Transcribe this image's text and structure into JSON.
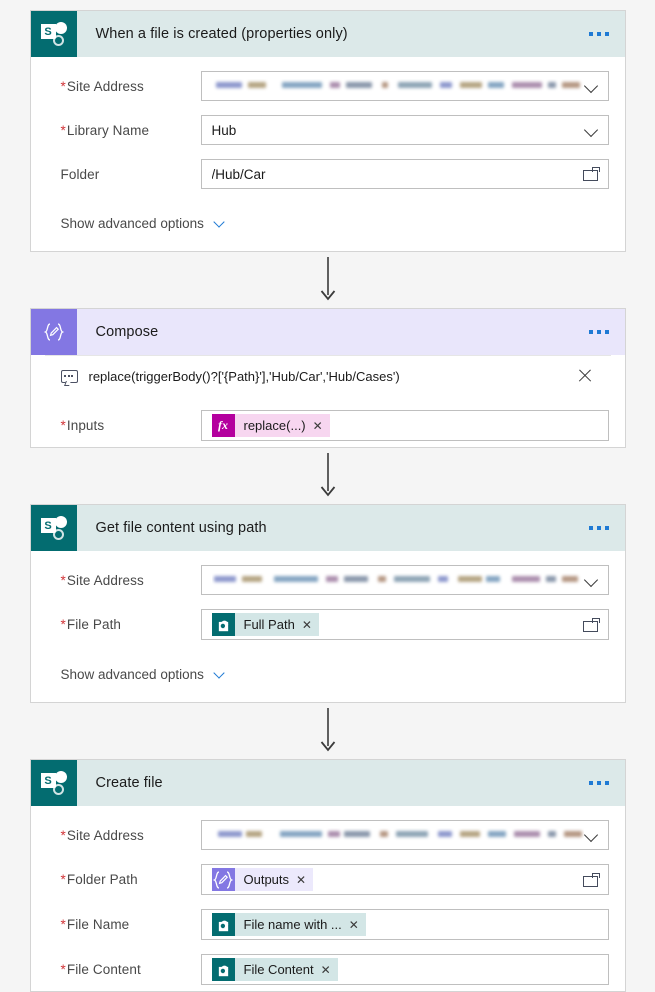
{
  "flow": {
    "blocks": [
      {
        "id": "trigger",
        "title": "When a file is created (properties only)",
        "icon": "sharepoint-icon",
        "theme": "sp",
        "fields": [
          {
            "label": "Site Address",
            "required": true,
            "type": "dropdown-blurred",
            "value": ""
          },
          {
            "label": "Library Name",
            "required": true,
            "type": "dropdown",
            "value": "Hub"
          },
          {
            "label": "Folder",
            "required": false,
            "type": "folder-picker",
            "value": "/Hub/Car"
          }
        ],
        "advanced_label": "Show advanced options"
      },
      {
        "id": "compose",
        "title": "Compose",
        "icon": "compose-icon",
        "theme": "cmp",
        "expression": "replace(triggerBody()?['{Path}'],'Hub/Car','Hub/Cases')",
        "fields": [
          {
            "label": "Inputs",
            "required": true,
            "type": "token",
            "token": {
              "text": "replace(...)",
              "icon": "fx-icon",
              "theme": "fx"
            }
          }
        ]
      },
      {
        "id": "get-file-content",
        "title": "Get file content using path",
        "icon": "sharepoint-icon",
        "theme": "sp",
        "fields": [
          {
            "label": "Site Address",
            "required": true,
            "type": "dropdown-blurred",
            "value": ""
          },
          {
            "label": "File Path",
            "required": true,
            "type": "token-folder",
            "token": {
              "text": "Full Path",
              "icon": "sharepoint-icon",
              "theme": "sp"
            }
          }
        ],
        "advanced_label": "Show advanced options"
      },
      {
        "id": "create-file",
        "title": "Create file",
        "icon": "sharepoint-icon",
        "theme": "sp",
        "fields": [
          {
            "label": "Site Address",
            "required": true,
            "type": "dropdown-blurred",
            "value": ""
          },
          {
            "label": "Folder Path",
            "required": true,
            "type": "token-folder",
            "token": {
              "text": "Outputs",
              "icon": "compose-icon",
              "theme": "cmp"
            }
          },
          {
            "label": "File Name",
            "required": true,
            "type": "token",
            "token": {
              "text": "File name with ...",
              "icon": "sharepoint-icon",
              "theme": "sp"
            }
          },
          {
            "label": "File Content",
            "required": true,
            "type": "token",
            "token": {
              "text": "File Content",
              "icon": "sharepoint-icon",
              "theme": "sp"
            }
          }
        ]
      }
    ],
    "menu_label": "more-commands",
    "remove_label": "x"
  },
  "colors": {
    "sharepoint_teal": "#036c70",
    "sharepoint_header": "#dce9e9",
    "compose_purple": "#8377e3",
    "compose_header": "#e9e6fb",
    "fx_magenta": "#b4009e",
    "required_red": "#d13438",
    "link_blue": "#1f7ad4",
    "page_background": "#f5f5f5"
  }
}
